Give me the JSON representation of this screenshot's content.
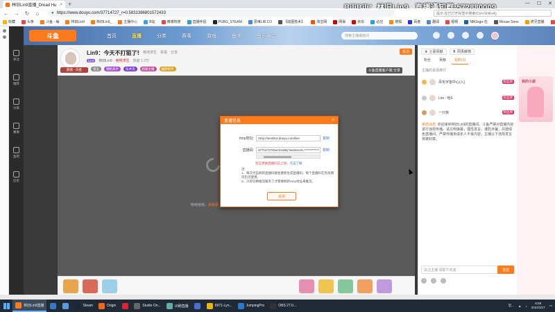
{
  "browser": {
    "tab_title": "林旧Lin9直播_Dread Hu",
    "new_tab": "+",
    "url": "https://www.douyu.com/37714727_r=0.5831386801572433",
    "search_placeholder": "提示:在已打开标签中搜索(Ctrl+Shift+A)",
    "bookmarks": [
      "收藏",
      "头条",
      "斗鱼 - 每",
      "林旧Lin9",
      "林旧Lin9_",
      "主播中心",
      "B站",
      "微博热搜",
      "直播伴侣",
      "PUBG_STEAM",
      "思维LIB.CO",
      "【底图技术】",
      "淘宝网",
      "网易",
      "京东",
      "必应",
      "搜狐",
      "百度",
      "翻译",
      "视频",
      "NBGsgo-在",
      "Mouse Sens",
      "虎牙直播",
      "今日",
      "微博",
      "百科",
      "优酷",
      "360",
      "KRAFTON_G"
    ],
    "window_controls": [
      "—",
      "☐",
      "✕"
    ]
  },
  "overlay_text": "BiliBili：林旧Lin9_ 直播通知群:572880009",
  "site": {
    "logo": "斗鱼",
    "nav": [
      "首页",
      "直播",
      "分类",
      "赛事",
      "游戏",
      "鱼吧",
      "鱼乐大会"
    ],
    "nav_active_index": 1,
    "search_placeholder": "搜索主播或房间",
    "left_nav": [
      "关注",
      "推荐",
      "分类",
      "赛事",
      "鱼吧",
      "历史"
    ]
  },
  "streamer": {
    "title": "Lin9：今天不打狙了！",
    "meta": [
      "分类",
      "绝地求生",
      "举报",
      "分享"
    ],
    "level": "Lv.4",
    "name": "林旧Lin9",
    "category": "绝地求生",
    "hot": "热度 1.2万",
    "tags": [
      {
        "label": "狙击",
        "color": "#888888"
      },
      {
        "label": "钢枪高手",
        "color": "#a64fd6"
      },
      {
        "label": "技术流",
        "color": "#7a3fd0"
      },
      {
        "label": "超级主播",
        "color": "#c04fa0"
      },
      {
        "label": "幽默搞笑",
        "color": "#d8a020"
      }
    ],
    "avatar_tag": "颜值 · 白金",
    "follow": "关注",
    "share_bar": "斗鱼直播客户端  分享"
  },
  "video": {
    "caption_prefix": "哈哈哈哈，",
    "caption_highlight": "快来看"
  },
  "modal": {
    "title": "直播信息",
    "close": "×",
    "rtmp_label": "rtmp地址:",
    "rtmp_value": "rtmp://sendtc3.douyu.com/live",
    "key_label": "直播码:",
    "key_value": "37714727rDuclzHd8y?wsSecret=************",
    "copy": "复制",
    "warn": "您已更换直播码已上线，",
    "warn_link": "点击了解",
    "note_title": "注:",
    "notes": [
      "1、每次点击刷新直播码都会重新生成直播码，每个直播码在有效期内仍可使用。",
      "2、只有切换推流服务了才需要刷新rtmp地址来推流。"
    ],
    "button": "关闭"
  },
  "right_panel": {
    "tabs": [
      "土豪贡献",
      "周贡献榜"
    ],
    "subtabs": [
      "粉丝",
      "贡献",
      "钻粉(1)"
    ],
    "subhead": "主播的本场排行",
    "ranks": [
      {
        "name": "吊毛宇宙中心(入)",
        "badge": "粉丝牌"
      },
      {
        "name": "Lim - 哈9",
        "badge": "粉丝牌"
      },
      {
        "name": "一只林",
        "badge": "粉丝牌"
      }
    ],
    "system_label": "系统消息:",
    "notice": "欢迎来到林旧Lin9的直播间。斗鱼严禁对直播内容进行违规传播。请文明弹幕，理性发言，谨防诈骗，共建绿色直播间。严禁传播未成年人不良内容，主播以下违规发言将被封禁。",
    "chat_placeholder": "关注主播  领取下欢迎",
    "send": "发送"
  },
  "ad": {
    "title": "我的小屋"
  },
  "taskbar": {
    "items": [
      {
        "label": "林旧Lin9直播",
        "active": true
      },
      {
        "label": "",
        "active": false
      },
      {
        "label": "",
        "active": false
      },
      {
        "label": "Steam",
        "active": false
      },
      {
        "label": "Origin",
        "active": false
      },
      {
        "label": "",
        "active": false
      },
      {
        "label": "Studio On...",
        "active": false
      },
      {
        "label": "UI刷直播",
        "active": false
      },
      {
        "label": "",
        "active": false
      },
      {
        "label": "6971-Lyn...",
        "active": false
      },
      {
        "label": "JumpingPro",
        "active": false
      },
      {
        "label": "OBS 27.0...",
        "active": false
      }
    ],
    "tray_text": "近...",
    "time": "6:58",
    "date": "2022/3/17"
  },
  "colors": {
    "accent": "#ff7a1a",
    "video_bg": "#5a5a5a",
    "taskbar": "#1f2a36"
  }
}
